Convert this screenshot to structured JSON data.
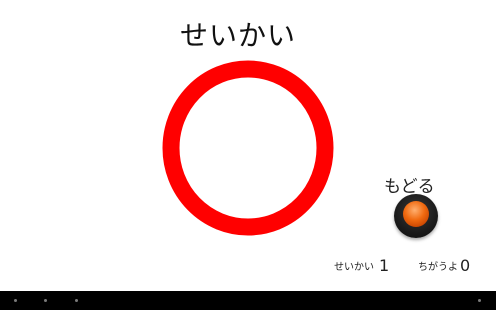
{
  "result": {
    "title": "せいかい",
    "mark_icon": "red-circle-maru-icon",
    "mark_color": "#ff0000"
  },
  "back": {
    "label": "もどる",
    "button_icon": "orange-round-button-icon",
    "button_color": "#f06a10"
  },
  "score": {
    "correct_label": "せいかい",
    "correct_value": "1",
    "wrong_label": "ちがうよ",
    "wrong_value": "0"
  },
  "navbar": {
    "color": "#000000"
  }
}
